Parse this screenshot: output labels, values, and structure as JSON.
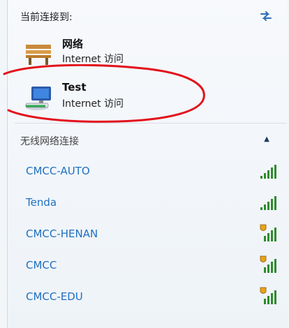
{
  "header": {
    "connected_label": "当前连接到:"
  },
  "connections": [
    {
      "name": "网络",
      "access": "Internet 访问",
      "icon": "bench-icon"
    },
    {
      "name": "Test",
      "access": "Internet 访问",
      "icon": "network-computer-icon"
    }
  ],
  "wireless": {
    "section_label": "无线网络连接",
    "collapse_glyph": "▲",
    "networks": [
      {
        "name": "CMCC-AUTO",
        "secured": false,
        "signal_bars": 5
      },
      {
        "name": "Tenda",
        "secured": false,
        "signal_bars": 5
      },
      {
        "name": "CMCC-HENAN",
        "secured": true,
        "signal_bars": 5
      },
      {
        "name": "CMCC",
        "secured": true,
        "signal_bars": 5
      },
      {
        "name": "CMCC-EDU",
        "secured": true,
        "signal_bars": 5
      }
    ]
  },
  "colors": {
    "link": "#1f6fc1",
    "signal": "#2e8b2e",
    "shield": "#e8a317",
    "annotation": "#e2121b"
  }
}
